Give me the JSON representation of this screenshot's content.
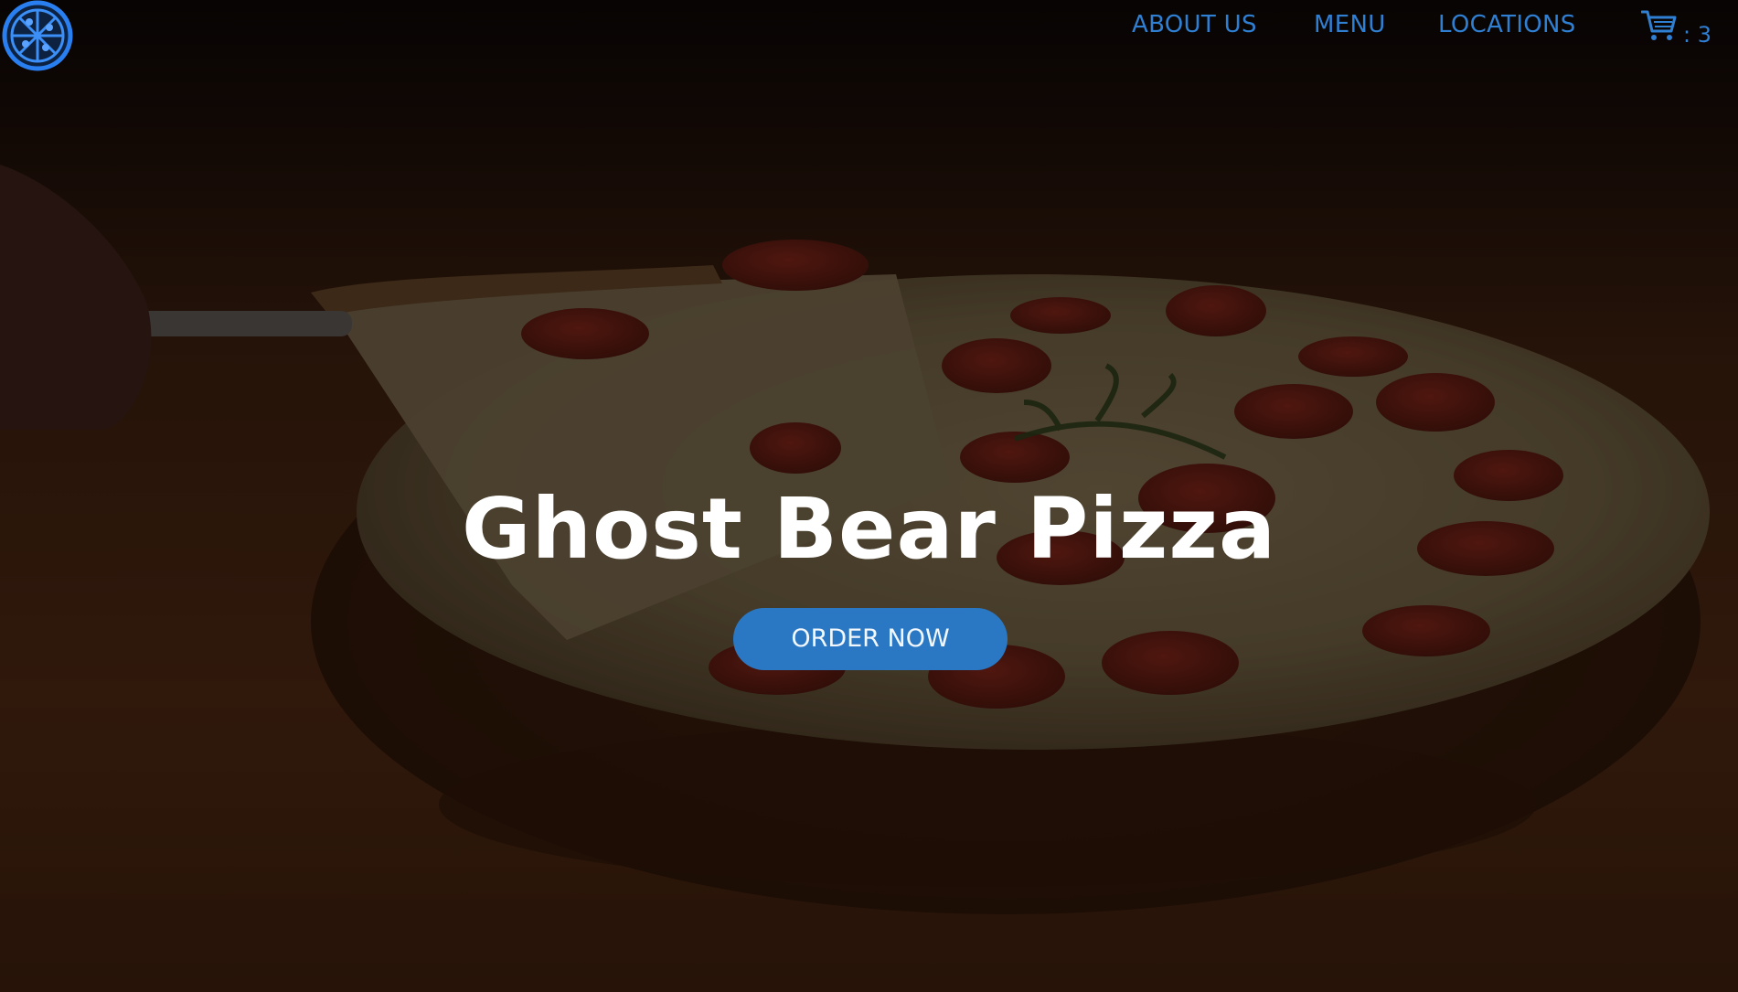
{
  "nav": {
    "links": [
      {
        "label": "ABOUT US"
      },
      {
        "label": "MENU"
      },
      {
        "label": "LOCATIONS"
      }
    ],
    "cart": {
      "count_text": ": 3",
      "icon": "cart-icon"
    },
    "logo_icon": "pizza-logo-icon"
  },
  "hero": {
    "title": "Ghost Bear Pizza",
    "cta_label": "ORDER NOW",
    "background_image": "pepperoni-pizza-photo"
  },
  "colors": {
    "nav_accent": "#2f7fd3",
    "cta_background": "#2a78c4",
    "title_text": "#ffffff"
  }
}
